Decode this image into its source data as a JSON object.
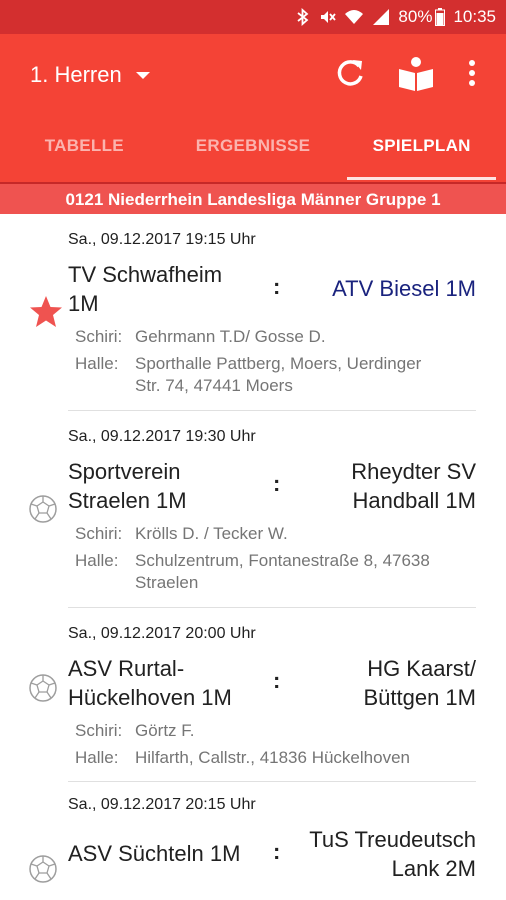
{
  "status_bar": {
    "battery": "80%",
    "time": "10:35"
  },
  "app_bar": {
    "title": "1. Herren"
  },
  "tabs": [
    {
      "label": "TABELLE"
    },
    {
      "label": "ERGEBNISSE"
    },
    {
      "label": "SPIELPLAN"
    }
  ],
  "group": {
    "label": "0121 Niederrhein Landesliga Männer Gruppe 1"
  },
  "labels": {
    "schiri": "Schiri:",
    "halle": "Halle:",
    "separator": ":"
  },
  "matches": [
    {
      "date": "Sa., 09.12.2017  19:15 Uhr",
      "home_line1": "TV Schwafheim",
      "home_line2": "1M",
      "away_line1": "ATV Biesel 1M",
      "away_line2": "",
      "schiri": "Gehrmann T.D/ Gosse D.",
      "halle_line1": "Sporthalle Pattberg, Moers, Uerdinger",
      "halle_line2": "Str. 74, 47441 Moers",
      "icon": "star-icon"
    },
    {
      "date": "Sa., 09.12.2017  19:30 Uhr",
      "home_line1": "Sportverein",
      "home_line2": "Straelen 1M",
      "away_line1": "Rheydter SV",
      "away_line2": "Handball 1M",
      "schiri": "Krölls D. / Tecker W.",
      "halle_line1": "Schulzentrum, Fontanestraße 8, 47638",
      "halle_line2": "Straelen",
      "icon": "handball-icon"
    },
    {
      "date": "Sa., 09.12.2017  20:00 Uhr",
      "home_line1": "ASV Rurtal-",
      "home_line2": "Hückelhoven 1M",
      "away_line1": "HG Kaarst/",
      "away_line2": "Büttgen 1M",
      "schiri": "Görtz F.",
      "halle_line1": "Hilfarth, Callstr., 41836 Hückelhoven",
      "halle_line2": "",
      "icon": "handball-icon"
    },
    {
      "date": "Sa., 09.12.2017  20:15 Uhr",
      "home_line1": "ASV Süchteln 1M",
      "home_line2": "",
      "away_line1": "TuS Treudeutsch",
      "away_line2": "Lank 2M",
      "icon": "handball-icon"
    }
  ],
  "colors": {
    "primary": "#f44336",
    "status_bar": "#d32f2f",
    "favorite_team": "#1a237e",
    "star": "#ef5350"
  }
}
